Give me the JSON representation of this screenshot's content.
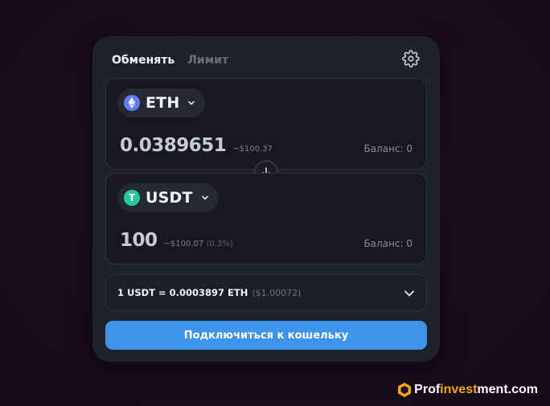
{
  "tabs": [
    {
      "label": "Обменять",
      "active": true
    },
    {
      "label": "Лимит",
      "active": false
    }
  ],
  "icons": {
    "settings": "gear-icon",
    "swap": "arrow-down-icon",
    "chevron": "chevron-down-icon"
  },
  "from": {
    "token": "ETH",
    "token_icon": "ethereum-icon",
    "amount": "0.0389651",
    "usd_value": "~$100.37",
    "balance": "Баланс: 0"
  },
  "to": {
    "token": "USDT",
    "token_icon": "tether-icon",
    "token_glyph": "T",
    "amount": "100",
    "usd_value": "~$100.07",
    "price_impact": "(0.3%)",
    "balance": "Баланс: 0"
  },
  "rate": {
    "text": "1 USDT = 0.0003897 ETH",
    "usd": "($1.00072)"
  },
  "connect_button": "Подключиться к кошельку",
  "watermark": {
    "part1": "Prof",
    "part2": "invest",
    "part3": "ment.com"
  },
  "colors": {
    "accent": "#3d94e9",
    "eth": "#627eea",
    "usdt": "#26c99e",
    "watermark_orange": "#f2a51a"
  }
}
